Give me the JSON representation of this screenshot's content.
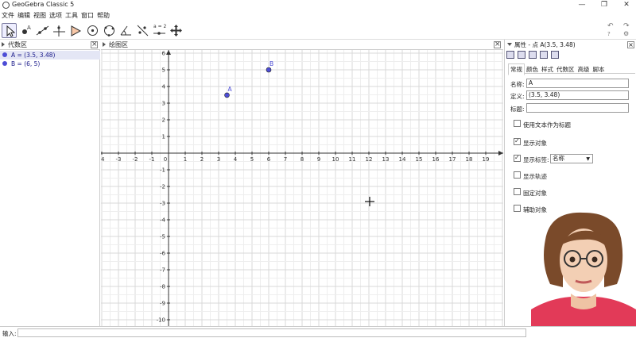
{
  "window": {
    "title": "GeoGebra Classic 5",
    "min": "—",
    "restore": "❐",
    "close": "✕"
  },
  "menu": [
    "文件",
    "编辑",
    "视图",
    "选项",
    "工具",
    "窗口",
    "帮助"
  ],
  "toolbar": {
    "tools": [
      "move-tool",
      "point-tool",
      "line-tool",
      "perpendicular-tool",
      "polygon-tool",
      "circle-tool",
      "circle-three-points-tool",
      "angle-tool",
      "reflect-tool",
      "slider-tool",
      "move-graphics-tool"
    ],
    "slider_label": "a = 2",
    "undo": "↶",
    "redo": "↷",
    "help": "?",
    "settings": "⚙"
  },
  "algebra": {
    "title": "代数区",
    "items": [
      {
        "label": "A = (3.5, 3.48)",
        "color": "#4d4dd6"
      },
      {
        "label": "B = (6, 5)",
        "color": "#4d4dd6"
      }
    ]
  },
  "graphics": {
    "title": "绘图区",
    "x_ticks": [
      "-4",
      "-3",
      "-2",
      "-1",
      "0",
      "1",
      "2",
      "3",
      "4",
      "5",
      "6",
      "7",
      "8",
      "9",
      "10",
      "11",
      "12",
      "13",
      "14",
      "15",
      "16",
      "17",
      "18",
      "19"
    ],
    "y_ticks": [
      "6",
      "5",
      "4",
      "3",
      "2",
      "1",
      "-1",
      "-2",
      "-3",
      "-4",
      "-5",
      "-6",
      "-7",
      "-8",
      "-9",
      "-10"
    ],
    "points": [
      {
        "name": "A",
        "x": 3.5,
        "y": 3.48
      },
      {
        "name": "B",
        "x": 6,
        "y": 5
      }
    ],
    "point_color": "#4d4dd6"
  },
  "properties": {
    "title": "属性 - 点 A(3.5, 3.48)",
    "tabs": [
      "常规",
      "颜色",
      "样式",
      "代数区",
      "高级",
      "脚本"
    ],
    "name_label": "名称:",
    "name_value": "A",
    "definition_label": "定义:",
    "definition_value": "(3.5, 3.48)",
    "caption_label": "标题:",
    "caption_value": "",
    "use_text_as_caption": "使用文本作为标题",
    "show_object": "显示对象",
    "show_label": "显示标签:",
    "label_mode": "名称",
    "show_trace": "显示轨迹",
    "fix_object": "固定对象",
    "auxiliary_object": "辅助对象"
  },
  "input": {
    "label": "输入:"
  }
}
